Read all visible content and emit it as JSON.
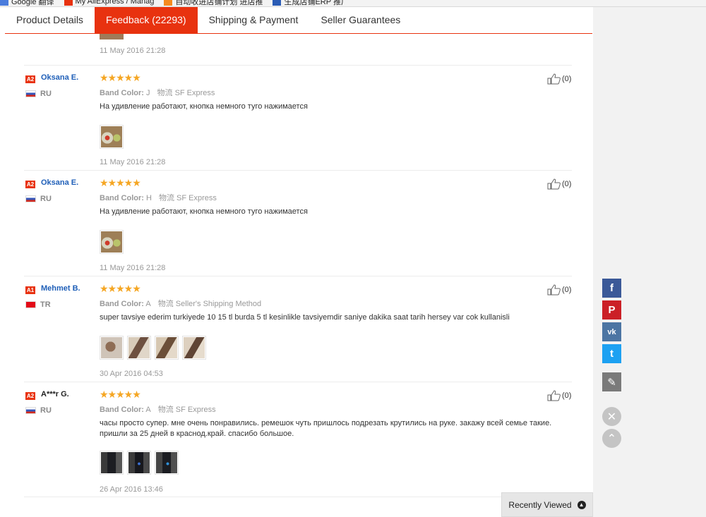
{
  "bookmarks": [
    {
      "label": "Google 翻译",
      "icon": "google-translate-icon",
      "color": "#4a7cdc"
    },
    {
      "label": "My AliExpress / Manag",
      "icon": "aliexpress-icon",
      "color": "#e8320f"
    },
    {
      "label": "自动收进店铺计划 进店推",
      "icon": "store-icon",
      "color": "#f58a1f"
    },
    {
      "label": "生成店铺ERP 推广",
      "icon": "erp-icon",
      "color": "#2b5cb5"
    }
  ],
  "tabs": [
    {
      "label": "Product Details",
      "active": false
    },
    {
      "label": "Feedback (22293)",
      "active": true
    },
    {
      "label": "Shipping & Payment",
      "active": false
    },
    {
      "label": "Seller Guarantees",
      "active": false
    }
  ],
  "top_date": "11 May 2016 21:28",
  "reviews": [
    {
      "level": "A2",
      "name": "Oksana E.",
      "country": "RU",
      "stars": "★★★★★",
      "color_label": "Band Color:",
      "color_value": "J",
      "ship": "物流 SF Express",
      "text": "На удивление работают, кнопка немного туго нажимается",
      "date": "11 May 2016 21:28",
      "helpful": "(0)"
    },
    {
      "level": "A2",
      "name": "Oksana E.",
      "country": "RU",
      "stars": "★★★★★",
      "color_label": "Band Color:",
      "color_value": "H",
      "ship": "物流 SF Express",
      "text": "На удивление работают, кнопка немного туго нажимается",
      "date": "11 May 2016 21:28",
      "helpful": "(0)"
    },
    {
      "level": "A1",
      "name": "Mehmet B.",
      "country": "TR",
      "stars": "★★★★★",
      "color_label": "Band Color:",
      "color_value": "A",
      "ship": "物流 Seller's Shipping Method",
      "text": "super tavsiye ederim turkiyede 10 15 tl burda 5 tl kesinlikle tavsiyemdir saniye dakika saat tarih hersey var cok kullanisli",
      "date": "30 Apr 2016 04:53",
      "helpful": "(0)"
    },
    {
      "level": "A2",
      "name": "A***r G.",
      "country": "RU",
      "stars": "★★★★★",
      "color_label": "Band Color:",
      "color_value": "A",
      "ship": "物流 SF Express",
      "text": "часы просто супер. мне очень понравились. ремешок чуть пришлось подрезать крутились на руке. закажу всей семье такие. пришли за 25 дней в краснод.край. спасибо большое.",
      "date": "26 Apr 2016 13:46",
      "helpful": "(0)"
    }
  ],
  "recently_viewed": "Recently Viewed",
  "share": [
    {
      "name": "facebook-icon",
      "glyph": "f",
      "color": "#3b5998"
    },
    {
      "name": "pinterest-icon",
      "glyph": "P",
      "color": "#cb2027"
    },
    {
      "name": "vk-icon",
      "glyph": "vk",
      "color": "#4c75a3"
    },
    {
      "name": "twitter-icon",
      "glyph": "t",
      "color": "#1da1f2"
    },
    {
      "name": "edit-icon",
      "glyph": "✎",
      "color": "#7a7a7a"
    }
  ]
}
